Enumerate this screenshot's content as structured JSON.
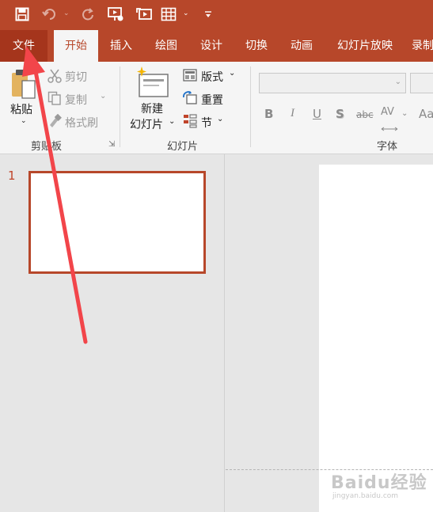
{
  "quick_access": {
    "icons": [
      "save-icon",
      "undo-icon",
      "redo-icon",
      "present-from-beginning-icon",
      "start-from-slide-icon",
      "table-icon",
      "customize-toolbar-icon"
    ]
  },
  "tabs": [
    {
      "label": "文件"
    },
    {
      "label": "开始"
    },
    {
      "label": "插入"
    },
    {
      "label": "绘图"
    },
    {
      "label": "设计"
    },
    {
      "label": "切换"
    },
    {
      "label": "动画"
    },
    {
      "label": "幻灯片放映"
    },
    {
      "label": "录制"
    }
  ],
  "ribbon": {
    "clipboard": {
      "paste": "粘贴",
      "cut": "剪切",
      "copy": "复制",
      "format_painter": "格式刷",
      "group_label": "剪贴板"
    },
    "slides": {
      "new_slide_line1": "新建",
      "new_slide_line2": "幻灯片",
      "layout": "版式",
      "reset": "重置",
      "section": "节",
      "group_label": "幻灯片"
    },
    "font": {
      "bold": "B",
      "italic": "I",
      "underline": "U",
      "shadow": "S",
      "strikethrough": "abc",
      "char_spacing": "AV",
      "change_case": "Aa",
      "group_label": "字体"
    }
  },
  "slide_pane": {
    "slide_number": "1"
  },
  "watermark": {
    "main": "Baidu经验",
    "sub": "jingyan.baidu.com"
  },
  "colors": {
    "accent": "#b7472a",
    "file_tab": "#a5351c",
    "annotation_arrow": "#f2454a"
  }
}
